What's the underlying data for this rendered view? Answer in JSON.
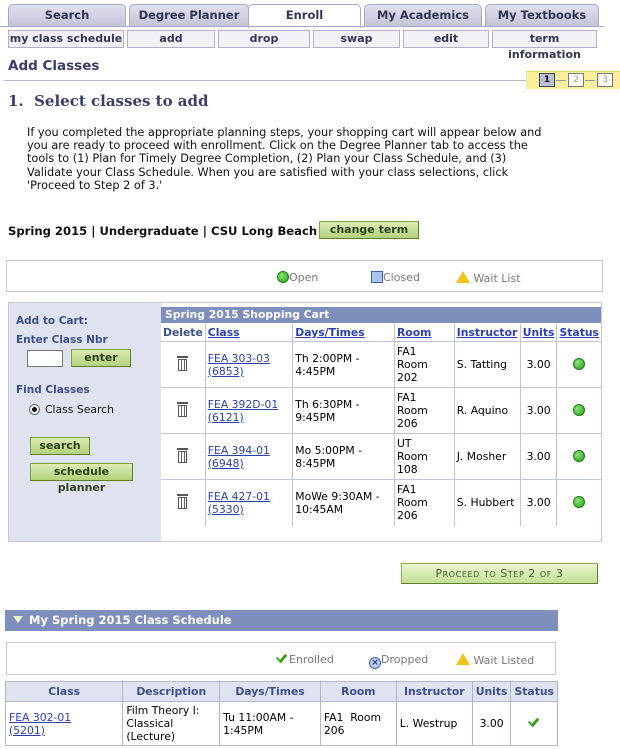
{
  "tabs": [
    "Search",
    "Degree Planner",
    "Enroll",
    "My Academics",
    "My Textbooks"
  ],
  "active_tab": "Enroll",
  "subtabs": [
    "my class schedule",
    "add",
    "drop",
    "swap",
    "edit",
    "term information"
  ],
  "page_title": "Add Classes",
  "steps": [
    "1",
    "2",
    "3"
  ],
  "step_heading": "1.  Select classes to add",
  "intro_text": "If you completed the appropriate planning steps, your shopping cart will appear below and you are ready to proceed with enrollment. Click on the Degree Planner tab to access the tools to (1) Plan for Timely Degree Completion, (2) Plan your Class Schedule, and (3) Validate your Class Schedule. When you are satisfied with your class selections, click 'Proceed to Step 2 of 3.'",
  "term": "Spring 2015 | Undergraduate | CSU Long Beach",
  "change_term_label": "change term",
  "legend": {
    "open": "Open",
    "closed": "Closed",
    "wait_list": "Wait List"
  },
  "left_panel": {
    "add_to_cart": "Add to Cart:",
    "enter_class_nbr": "Enter Class Nbr",
    "enter_button": "enter",
    "find_classes": "Find Classes",
    "class_search": "Class Search",
    "search_button": "search",
    "schedule_planner_button": "schedule planner"
  },
  "cart": {
    "caption": "Spring 2015 Shopping Cart",
    "headers": [
      "Delete",
      "Class",
      "Days/Times",
      "Room",
      "Instructor",
      "Units",
      "Status"
    ],
    "rows": [
      {
        "class": "FEA 303-03",
        "nbr": "(6853)",
        "days": "Th 2:00PM -",
        "times": "4:45PM",
        "room1": "FA1",
        "room2": "Room",
        "room3": "202",
        "instructor": "S. Tatting",
        "units": "3.00"
      },
      {
        "class": "FEA 392D-01",
        "nbr": "(6121)",
        "days": "Th 6:30PM -",
        "times": "9:45PM",
        "room1": "FA1",
        "room2": "Room",
        "room3": "206",
        "instructor": "R. Aquino",
        "units": "3.00"
      },
      {
        "class": "FEA 394-01",
        "nbr": "(6948)",
        "days": "Mo 5:00PM -",
        "times": "8:45PM",
        "room1": "UT",
        "room2": "Room",
        "room3": "108",
        "instructor": "J. Mosher",
        "units": "3.00"
      },
      {
        "class": "FEA 427-01",
        "nbr": "(5330)",
        "days": "MoWe 9:30AM -",
        "times": "10:45AM",
        "room1": "FA1",
        "room2": "Room",
        "room3": "206",
        "instructor": "S. Hubbert",
        "units": "3.00"
      }
    ]
  },
  "proceed_label": "Proceed to Step 2 of 3",
  "schedule": {
    "title": "My Spring 2015 Class Schedule",
    "legend": {
      "enrolled": "Enrolled",
      "dropped": "Dropped",
      "wait_listed": "Wait Listed"
    },
    "headers": [
      "Class",
      "Description",
      "Days/Times",
      "Room",
      "Instructor",
      "Units",
      "Status"
    ],
    "row": {
      "class": "FEA 302-01",
      "nbr": "(5201)",
      "desc1": "Film Theory I:",
      "desc2": "Classical",
      "desc3": "(Lecture)",
      "days": "Tu 11:00AM -",
      "times": "1:45PM",
      "room1": "FA1  Room",
      "room2": "206",
      "instructor": "L. Westrup",
      "units": "3.00"
    }
  }
}
